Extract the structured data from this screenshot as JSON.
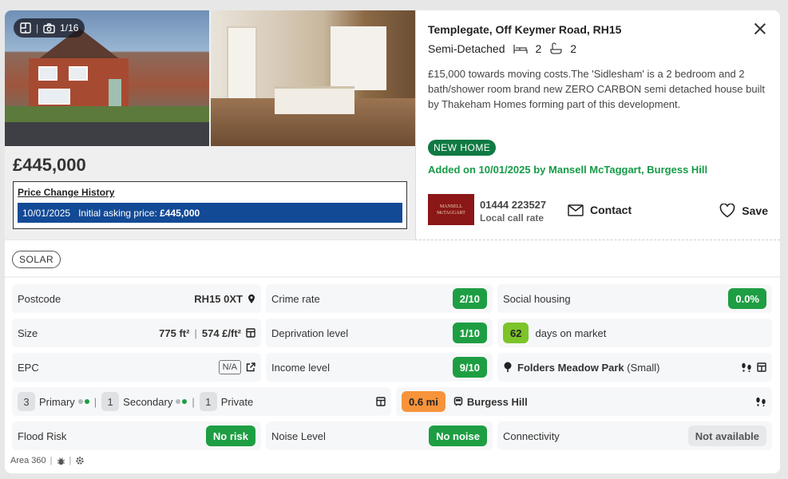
{
  "gallery": {
    "counter": "1/16"
  },
  "price": "£445,000",
  "price_history": {
    "title": "Price Change History",
    "entries": [
      {
        "date": "10/01/2025",
        "text": "Initial asking price:",
        "amount": "£445,000"
      }
    ]
  },
  "listing": {
    "address": "Templegate, Off Keymer Road, RH15",
    "type": "Semi-Detached",
    "bedrooms": "2",
    "bathrooms": "2",
    "description": "£15,000 towards moving costs.The 'Sidlesham' is a 2 bedroom and 2 bath/shower room brand new ZERO CARBON semi detached house built by Thakeham Homes forming part of this development.",
    "badge": "NEW HOME",
    "added": "Added on 10/01/2025 by Mansell McTaggart, Burgess Hill"
  },
  "agent": {
    "logo_line1": "MANSELL",
    "logo_line2": "McTAGGART",
    "phone": "01444 223527",
    "phone_note": "Local call rate",
    "contact_label": "Contact",
    "save_label": "Save"
  },
  "tag": "SOLAR",
  "stats": {
    "postcode": {
      "label": "Postcode",
      "value": "RH15 0XT"
    },
    "crime": {
      "label": "Crime rate",
      "value": "2/10"
    },
    "social": {
      "label": "Social housing",
      "value": "0.0%"
    },
    "size": {
      "label": "Size",
      "area": "775 ft²",
      "per": "574 £/ft²"
    },
    "deprivation": {
      "label": "Deprivation level",
      "value": "1/10"
    },
    "market": {
      "days": "62",
      "label": "days on market"
    },
    "epc": {
      "label": "EPC",
      "value": "N/A"
    },
    "income": {
      "label": "Income level",
      "value": "9/10"
    },
    "park": {
      "name": "Folders Meadow Park",
      "size": "(Small)"
    },
    "schools": {
      "primary_count": "3",
      "primary_label": "Primary",
      "secondary_count": "1",
      "secondary_label": "Secondary",
      "private_count": "1",
      "private_label": "Private"
    },
    "station": {
      "distance": "0.6 mi",
      "name": "Burgess Hill"
    },
    "flood": {
      "label": "Flood Risk",
      "value": "No risk"
    },
    "noise": {
      "label": "Noise Level",
      "value": "No noise"
    },
    "connectivity": {
      "label": "Connectivity",
      "value": "Not available"
    }
  },
  "footer": {
    "brand": "Area 360"
  },
  "colors": {
    "accent_blue": "#134a96",
    "green": "#1e9e43",
    "lime": "#7cc42a",
    "orange": "#f7933b",
    "new_home": "#0f7a43"
  }
}
